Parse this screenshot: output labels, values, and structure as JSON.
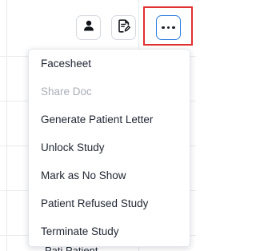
{
  "toolbar": {
    "buttons": [
      {
        "icon": "person-icon",
        "active": false
      },
      {
        "icon": "document-edit-icon",
        "active": false
      },
      {
        "icon": "more-options-icon",
        "active": true
      }
    ],
    "highlight_color": "#e0302f",
    "active_border_color": "#2d7fe0"
  },
  "menu": {
    "items": [
      {
        "label": "Facesheet",
        "disabled": false
      },
      {
        "label": "Share Doc",
        "disabled": true
      },
      {
        "label": "Generate Patient Letter",
        "disabled": false
      },
      {
        "label": "Unlock Study",
        "disabled": false
      },
      {
        "label": "Mark as No Show",
        "disabled": false
      },
      {
        "label": "Patient Refused Study",
        "disabled": false
      },
      {
        "label": "Terminate Study",
        "disabled": false
      }
    ]
  },
  "background": {
    "partial_text": "Pati Patient..."
  }
}
